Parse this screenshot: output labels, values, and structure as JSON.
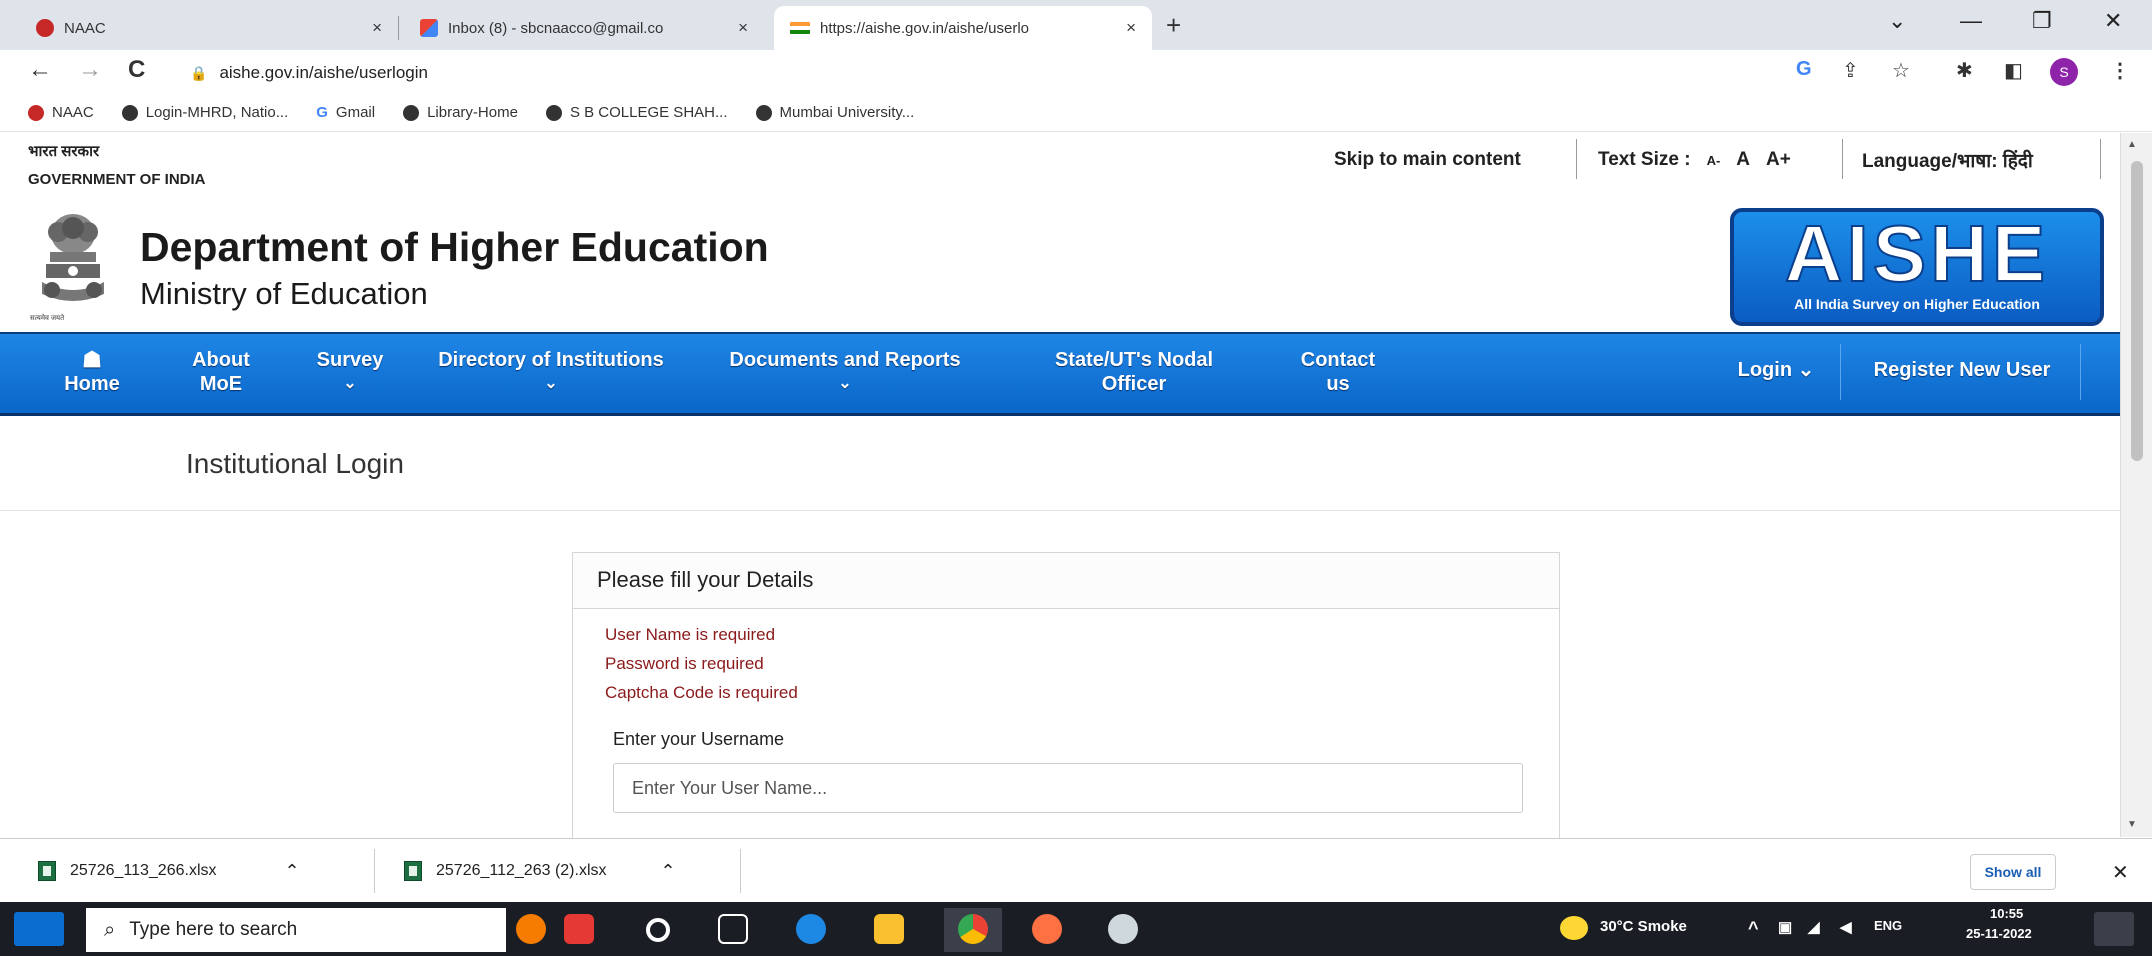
{
  "browser": {
    "tabs": [
      {
        "title": "NAAC",
        "close": "×"
      },
      {
        "title": "Inbox (8) - sbcnaacco@gmail.co",
        "close": "×"
      },
      {
        "title": "https://aishe.gov.in/aishe/userlo",
        "close": "×"
      }
    ],
    "new_tab": "+",
    "window_controls": {
      "dropdown": "⌄",
      "minimize": "—",
      "restore": "❐",
      "close": "✕"
    },
    "nav": {
      "back": "←",
      "forward": "→",
      "reload": "C"
    },
    "url": "aishe.gov.in/aishe/userlogin",
    "toolbar": {
      "google": "G",
      "share": "⇪",
      "star": "☆",
      "extensions": "✱",
      "sidepanel": "◧",
      "profile": "S",
      "menu": "⋮"
    },
    "bookmarks": [
      "NAAC",
      "Login-MHRD, Natio...",
      "Gmail",
      "Library-Home",
      "S B COLLEGE SHAH...",
      "Mumbai University..."
    ]
  },
  "gov_strip": {
    "hindi": "भारत सरकार",
    "english": "GOVERNMENT OF INDIA",
    "skip": "Skip to main content",
    "text_size_label": "Text Size :",
    "text_size_options": [
      "A-",
      "A",
      "A+"
    ],
    "language": "Language/भाषा: हिंदी"
  },
  "site_header": {
    "title": "Department of Higher Education",
    "subtitle": "Ministry of Education",
    "emblem_caption": "सत्यमेव जयते",
    "logo_text": "AISHE",
    "logo_tagline": "All India Survey on Higher Education"
  },
  "nav": {
    "home": {
      "icon": "☗",
      "label": "Home"
    },
    "about": {
      "line1": "About",
      "line2": "MoE"
    },
    "survey": {
      "label": "Survey",
      "chevron": "⌄"
    },
    "directory": {
      "label": "Directory of Institutions",
      "chevron": "⌄"
    },
    "documents": {
      "label": "Documents and Reports",
      "chevron": "⌄"
    },
    "nodal": {
      "line1": "State/UT's Nodal",
      "line2": "Officer"
    },
    "contact": {
      "line1": "Contact",
      "line2": "us"
    },
    "login": "Login ⌄",
    "register": "Register New User"
  },
  "page": {
    "title": "Institutional Login",
    "card_title": "Please fill your Details",
    "errors": [
      "User Name is required",
      "Password is required",
      "Captcha Code is required"
    ],
    "username_label": "Enter your Username",
    "username_placeholder": "Enter Your User Name..."
  },
  "downloads": {
    "items": [
      {
        "file": "25726_113_266.xlsx",
        "chevron": "⌃"
      },
      {
        "file": "25726_112_263 (2).xlsx",
        "chevron": "⌃"
      }
    ],
    "show_all": "Show all",
    "close": "✕"
  },
  "taskbar": {
    "search_placeholder": "Type here to search",
    "weather": "30°C Smoke",
    "lang": "ENG",
    "time": "10:55",
    "date": "25-11-2022"
  }
}
